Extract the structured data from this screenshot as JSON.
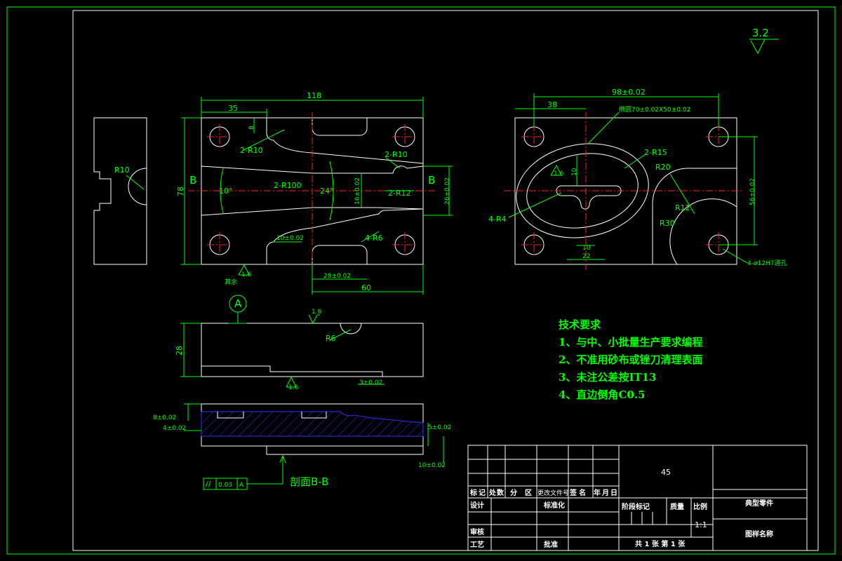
{
  "roughness": {
    "main": "3.2",
    "surface_a": "1.6",
    "surface_b": "1.6",
    "surface_c": "1.6",
    "surface_d": "1.6",
    "surface_e": "1.6"
  },
  "left_view": {
    "dim_total": "118",
    "dim_35": "35",
    "dim_8": "8",
    "dim_78": "78",
    "label_2r10_left": "2-R10",
    "label_2r10_right": "2-R10",
    "label_2r100": "2-R100",
    "label_2r12": "2-R12",
    "angle_10": "10°",
    "angle_24": "24°",
    "dim_16": "16±0.02",
    "dim_26": "26±0.02",
    "dim_10": "10±0.02",
    "label_4r6": "4-R6",
    "dim_28": "28±0.02",
    "dim_60": "60",
    "section_b_left": "B",
    "section_b_right": "B",
    "roughness_tag": "其余"
  },
  "side_view": {
    "label_r10": "R10"
  },
  "right_view": {
    "dim_98": "98±0.02",
    "dim_38": "38",
    "dim_ellipse": "椭圆70±0.02X50±0.02",
    "label_2r15": "2-R15",
    "label_r20": "R20",
    "label_r12": "R12",
    "label_r30": "R30",
    "dim_10_vert": "10",
    "dim_56": "56±0.02",
    "label_4r4": "4-R4",
    "dim_10_bottom": "10",
    "dim_22": "22",
    "label_holes": "4-ø12H7通孔"
  },
  "middle_view": {
    "datum": "A",
    "dim_28": "28",
    "label_r6": "R6",
    "dim_3": "3±0.02"
  },
  "section_view": {
    "dim_8": "8±0.02",
    "dim_4": "4±0.02",
    "dim_5": "5±0.02",
    "dim_10": "10±0.02",
    "tolerance_symbol": "//",
    "tolerance_value": "0.03",
    "tolerance_datum": "A",
    "section_label": "剖面B-B"
  },
  "tech_req": {
    "title": "技术要求",
    "items": [
      "1、与中、小批量生产要求编程",
      "2、不准用砂布或锉刀清理表面",
      "3、未注公差按IT13",
      "4、直边倒角C0.5"
    ]
  },
  "title_block": {
    "material": "45",
    "part_name": "典型零件",
    "drawing_name": "图样名称",
    "row_header": [
      "标",
      "记",
      "处",
      "数",
      "分",
      "区",
      "更改文件号",
      "签",
      "名",
      "年",
      "月",
      "日"
    ],
    "design": "设计",
    "standard": "标准化",
    "review": "审核",
    "process": "工艺",
    "approve": "批准",
    "stage_mark": "阶段标记",
    "weight": "质量",
    "scale_label": "比例",
    "scale": "1:1",
    "sheets": "共 1 张  第 1 张"
  }
}
